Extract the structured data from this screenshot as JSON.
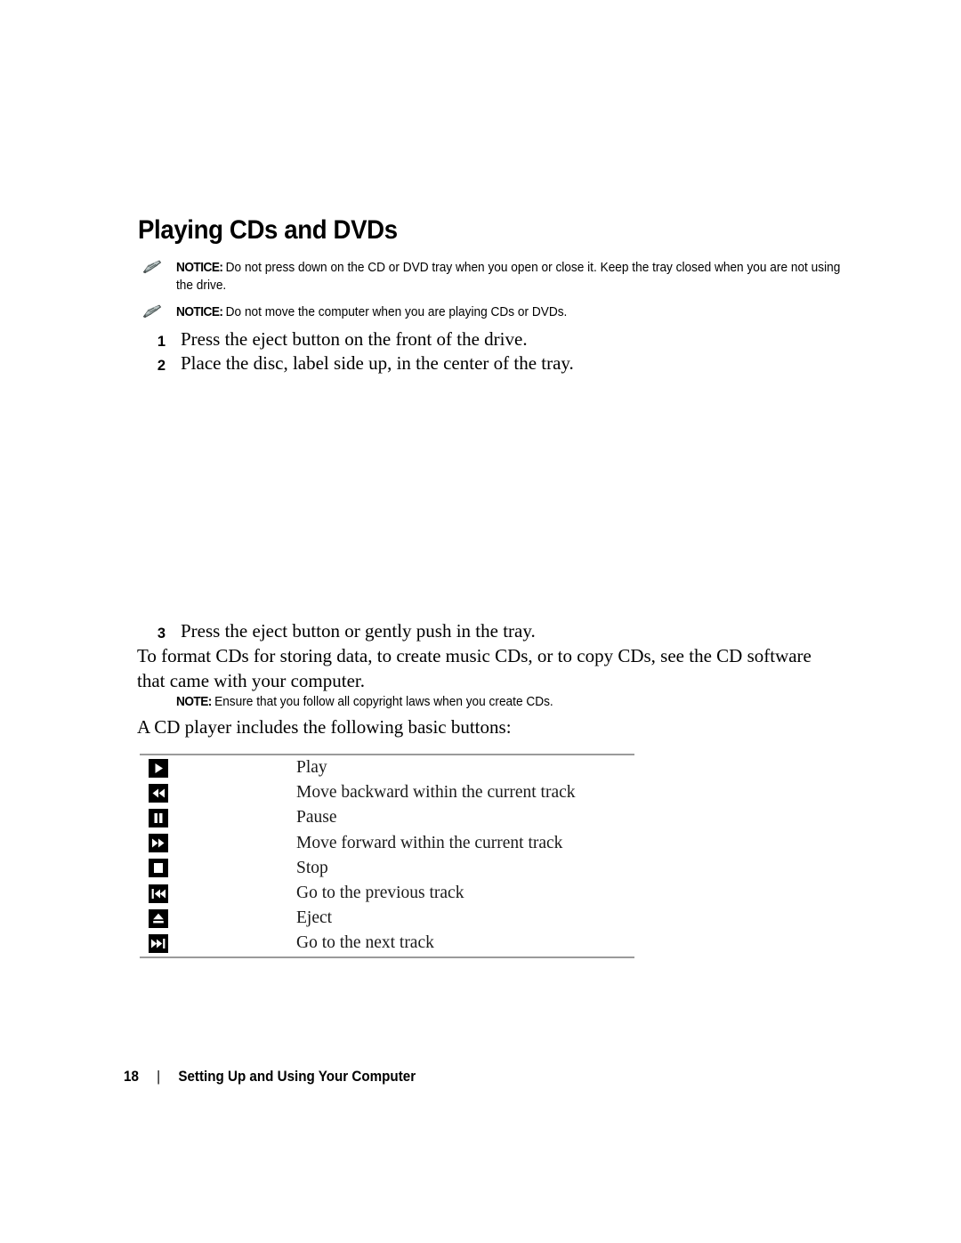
{
  "document": {
    "heading": "Playing CDs and DVDs"
  },
  "notices": [
    {
      "icon": "notice-pointer-icon",
      "label": "NOTICE:",
      "text": "Do not press down on the CD or DVD tray when you open or close it. Keep the tray closed when you are not using the drive."
    },
    {
      "icon": "notice-pointer-icon",
      "label": "NOTICE:",
      "text": "Do not move the computer when you are playing CDs or DVDs."
    }
  ],
  "steps": [
    {
      "number": "1",
      "text": "Press the eject button on the front of the drive."
    },
    {
      "number": "2",
      "text": "Place the disc, label side up, in the center of the tray."
    },
    {
      "number": "3",
      "text": "Press the eject button or gently push in the tray."
    }
  ],
  "paragraphs": {
    "format": "To format CDs for storing data, to create music CDs, or to copy CDs, see the CD software that came with your computer.",
    "buttons_intro": "A CD player includes the following basic buttons:"
  },
  "note": {
    "label": "NOTE:",
    "text": "Ensure that you follow all copyright laws when you create CDs."
  },
  "button_table": {
    "rows": [
      {
        "icon": "play-icon",
        "label": "Play"
      },
      {
        "icon": "rewind-icon",
        "label": "Move backward within the current track"
      },
      {
        "icon": "pause-icon",
        "label": "Pause"
      },
      {
        "icon": "fast-forward-icon",
        "label": "Move forward within the current track"
      },
      {
        "icon": "stop-icon",
        "label": "Stop"
      },
      {
        "icon": "previous-track-icon",
        "label": "Go to the previous track"
      },
      {
        "icon": "eject-icon",
        "label": "Eject"
      },
      {
        "icon": "next-track-icon",
        "label": "Go to the next track"
      }
    ]
  },
  "footer": {
    "page_number": "18",
    "separator": "|",
    "title": "Setting Up and Using Your Computer"
  },
  "colors": {
    "text": "#000000",
    "rule": "#9a9a9a",
    "icon_fill": "#000000",
    "icon_glyph": "#ffffff"
  }
}
